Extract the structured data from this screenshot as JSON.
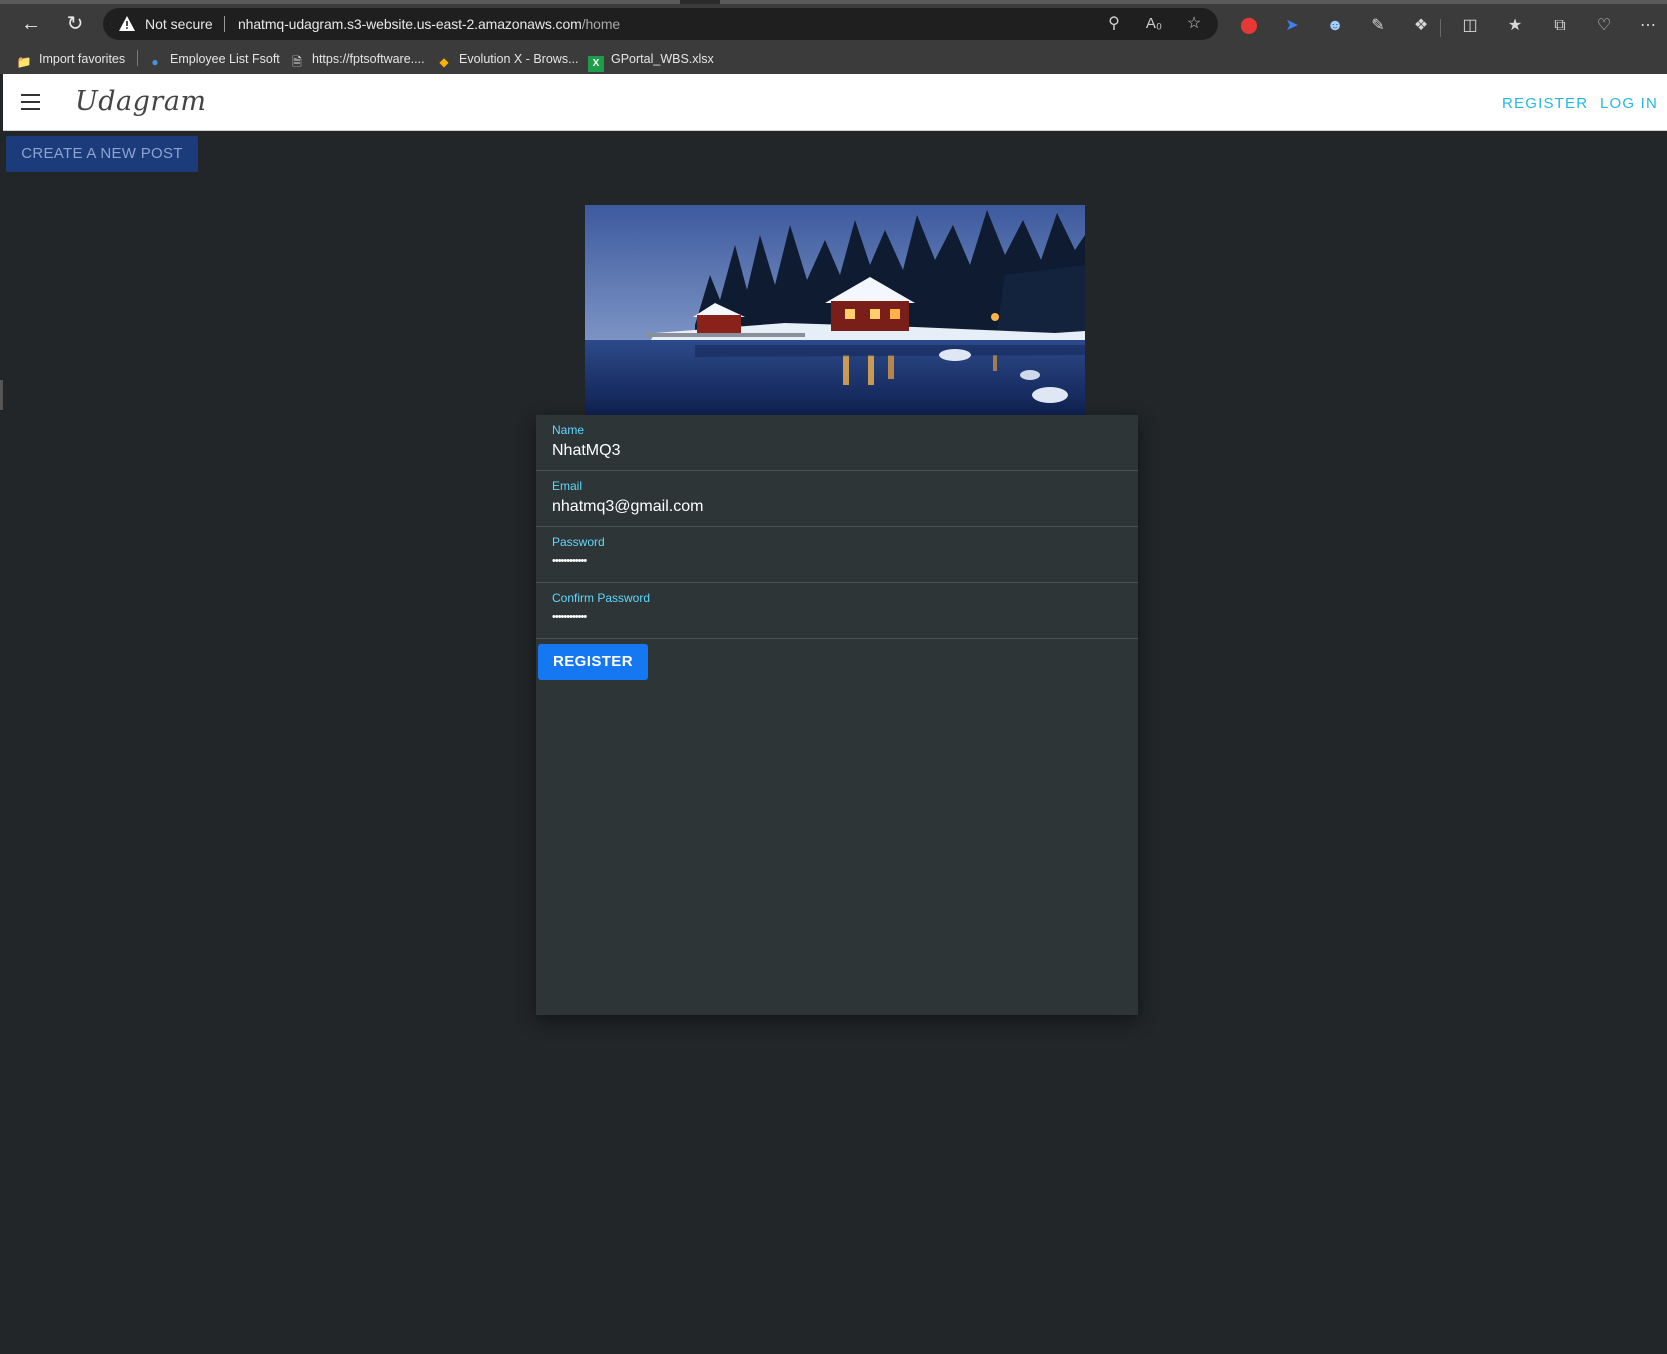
{
  "browser": {
    "security_label": "Not secure",
    "url_host": "nhatmq-udagram.s3-website.us-east-2.amazonaws.com",
    "url_path": "/home",
    "bookmarks": [
      {
        "label": "Import favorites",
        "icon": "import-icon"
      },
      {
        "label": "Employee List Fsoft",
        "icon": "globe-icon"
      },
      {
        "label": "https://fptsoftware....",
        "icon": "page-icon"
      },
      {
        "label": "Evolution X - Brows...",
        "icon": "evolution-icon"
      },
      {
        "label": "GPortal_WBS.xlsx",
        "icon": "excel-icon"
      }
    ]
  },
  "app": {
    "brand": "Udagram",
    "nav": {
      "register": "REGISTER",
      "login": "LOG IN"
    },
    "create_post": "CREATE A NEW POST"
  },
  "form": {
    "fields": [
      {
        "label": "Name",
        "value": "NhatMQ3"
      },
      {
        "label": "Email",
        "value": "nhatmq3@gmail.com"
      },
      {
        "label": "Password",
        "value": "••••••••••••"
      },
      {
        "label": "Confirm Password",
        "value": "••••••••••••"
      }
    ],
    "submit": "REGISTER"
  },
  "colors": {
    "accent_link": "#26b7e0",
    "field_label": "#5fd8ff",
    "primary_button": "#1677f2",
    "page_bg": "#222628",
    "card_bg": "#2e3537"
  }
}
